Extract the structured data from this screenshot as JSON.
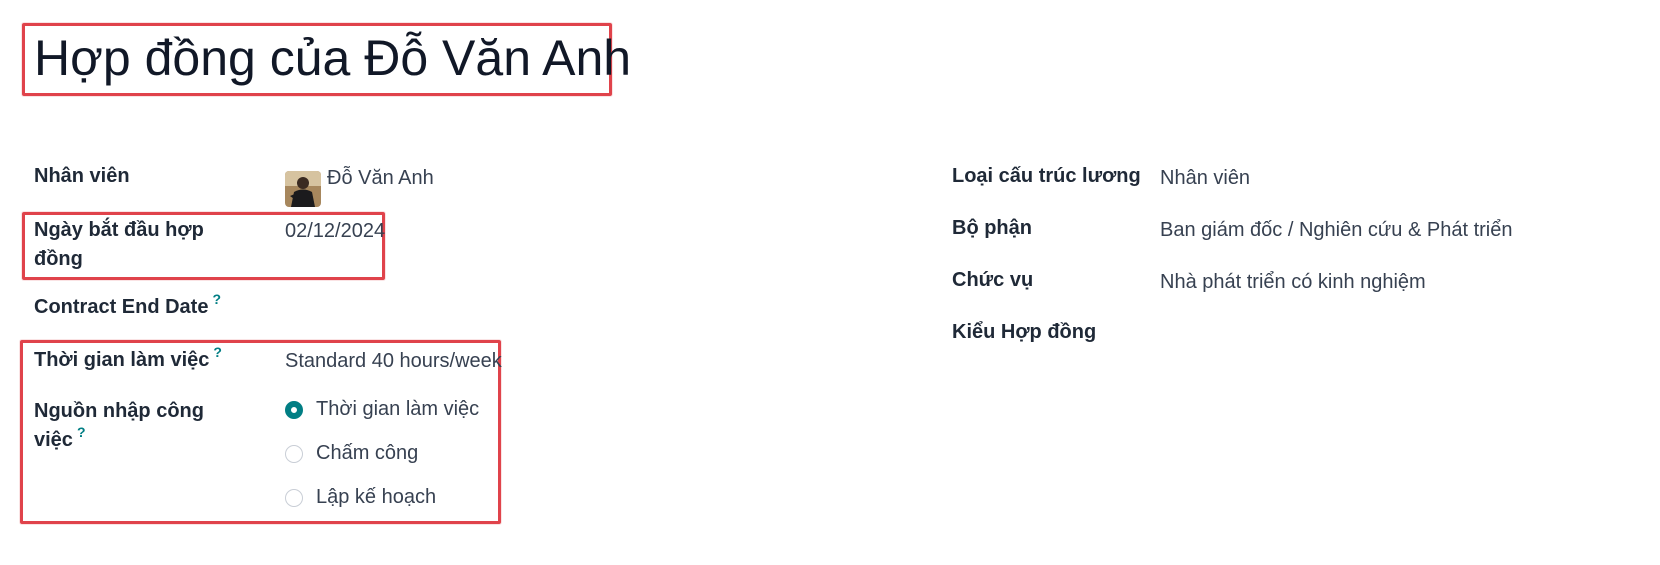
{
  "page": {
    "title": "Hợp đồng của Đỗ Văn Anh"
  },
  "left_fields": {
    "employee": {
      "label": "Nhân viên",
      "value": "Đỗ Văn Anh"
    },
    "start_date": {
      "label": "Ngày bắt đầu hợp đồng",
      "value": "02/12/2024"
    },
    "end_date": {
      "label": "Contract End Date",
      "help": "?"
    },
    "working_time": {
      "label": "Thời gian làm việc",
      "help": "?",
      "value": "Standard 40 hours/week"
    },
    "work_entry_source": {
      "label": "Nguồn nhập công việc",
      "help": "?",
      "options": [
        {
          "label": "Thời gian làm việc",
          "selected": true
        },
        {
          "label": "Chấm công",
          "selected": false
        },
        {
          "label": "Lập kế hoạch",
          "selected": false
        }
      ]
    }
  },
  "right_fields": {
    "salary_structure": {
      "label": "Loại cấu trúc lương",
      "value": "Nhân viên"
    },
    "department": {
      "label": "Bộ phận",
      "value": "Ban giám đốc / Nghiên cứu & Phát triển"
    },
    "job_position": {
      "label": "Chức vụ",
      "value": "Nhà phát triển có kinh nghiệm"
    },
    "contract_type": {
      "label": "Kiểu Hợp đồng"
    }
  },
  "colors": {
    "accent": "#017e84",
    "highlight_border": "#e0434b"
  }
}
